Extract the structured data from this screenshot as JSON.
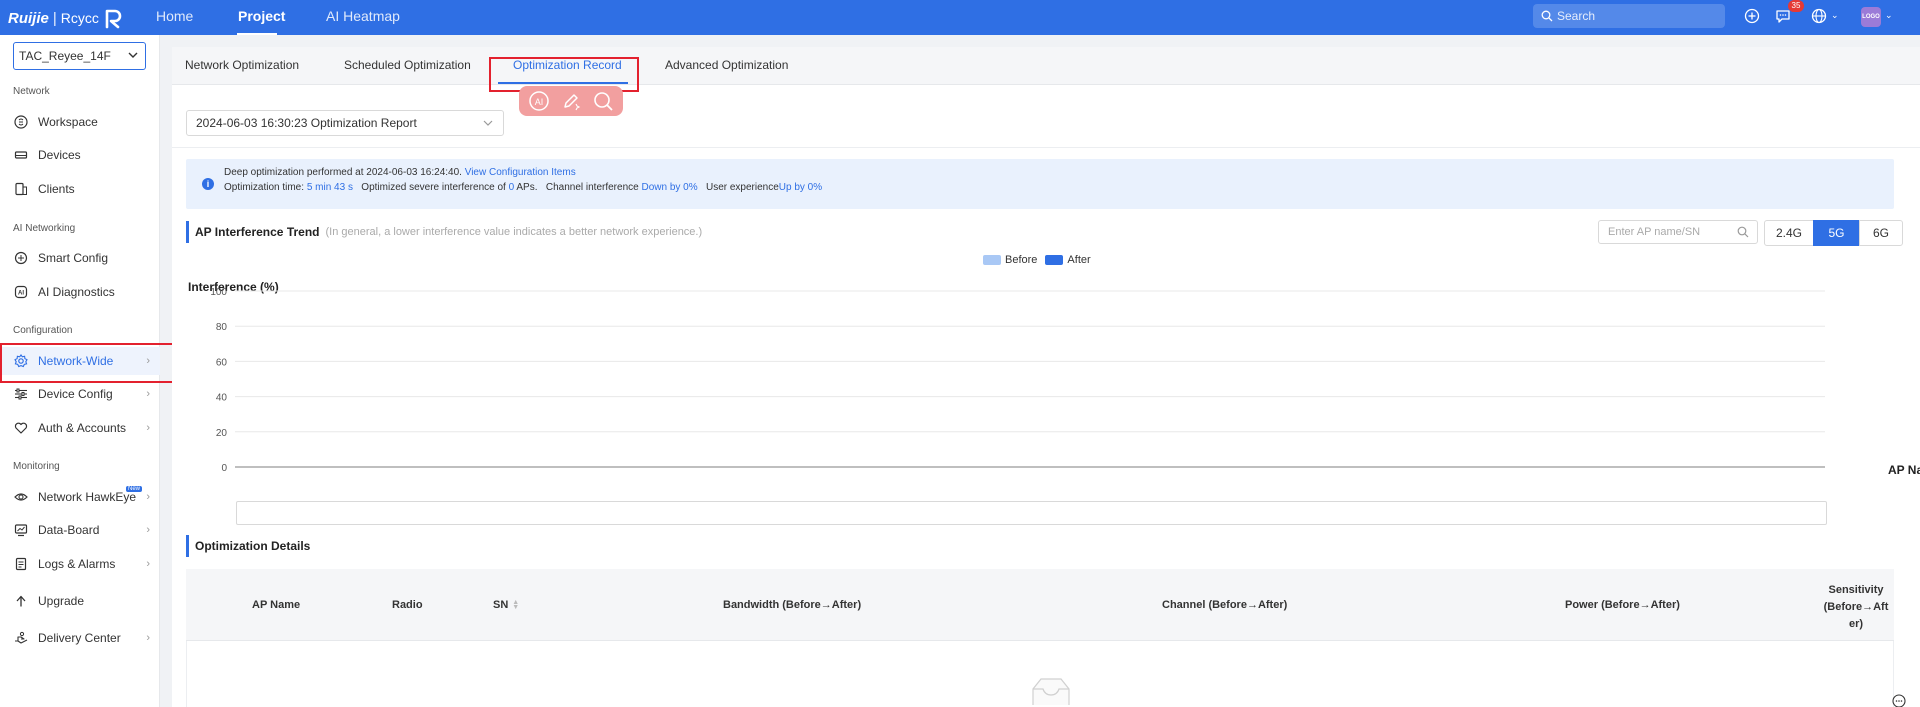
{
  "topbar": {
    "logo_brand": "Ruijie",
    "logo_sep": "|",
    "logo_product": "Rcycc",
    "nav": [
      {
        "label": "Home"
      },
      {
        "label": "Project"
      },
      {
        "label": "AI Heatmap"
      }
    ],
    "search_placeholder": "Search",
    "notification_count": "35",
    "avatar_text": "LOGO"
  },
  "sidebar": {
    "project": "TAC_Reyee_14F",
    "sections": {
      "network": "Network",
      "ai_networking": "AI Networking",
      "configuration": "Configuration",
      "monitoring": "Monitoring"
    },
    "items": {
      "workspace": "Workspace",
      "devices": "Devices",
      "clients": "Clients",
      "smart_config": "Smart Config",
      "ai_diagnostics": "AI Diagnostics",
      "network_wide": "Network-Wide",
      "device_config": "Device Config",
      "auth_accounts": "Auth & Accounts",
      "network_hawkeye": "Network HawkEye",
      "hawkeye_tag": "New",
      "data_board": "Data-Board",
      "logs_alarms": "Logs & Alarms",
      "upgrade": "Upgrade",
      "delivery_center": "Delivery Center"
    }
  },
  "tabs": [
    {
      "label": "Network Optimization"
    },
    {
      "label": "Scheduled Optimization"
    },
    {
      "label": "Optimization Record"
    },
    {
      "label": "Advanced Optimization"
    }
  ],
  "report_select": "2024-06-03 16:30:23 Optimization Report",
  "info": {
    "line1_text": "Deep optimization performed at 2024-06-03 16:24:40.",
    "line1_link": "View Configuration Items",
    "time_label": "Optimization time:",
    "time_value": "5 min 43 s",
    "severe_text": "Optimized severe interference of",
    "severe_value": "0",
    "severe_unit": "APs.",
    "channel_label": "Channel interference",
    "channel_value": "Down by 0%",
    "ux_label": "User experience",
    "ux_value": "Up by 0%"
  },
  "trend": {
    "title": "AP Interference Trend",
    "hint": "(In general, a lower interference value indicates a better network experience.)",
    "search_placeholder": "Enter AP name/SN",
    "bands": [
      "2.4G",
      "5G",
      "6G"
    ],
    "active_band": "5G"
  },
  "chart_data": {
    "type": "bar",
    "ylabel": "Interference (%)",
    "xlabel": "AP Name",
    "ylim": [
      0,
      100
    ],
    "yticks": [
      "100",
      "80",
      "60",
      "40",
      "20",
      "0"
    ],
    "categories": [],
    "series": [
      {
        "name": "Before",
        "values": [],
        "color": "#a9c8f5"
      },
      {
        "name": "After",
        "values": [],
        "color": "#2f6fe4"
      }
    ],
    "grid": true,
    "legend": "top-center"
  },
  "details": {
    "title": "Optimization Details",
    "columns": {
      "ap_name": "AP Name",
      "radio": "Radio",
      "sn": "SN",
      "bandwidth": "Bandwidth (Before→After)",
      "channel": "Channel (Before→After)",
      "power": "Power (Before→After)",
      "sensitivity_l1": "Sensitivity",
      "sensitivity_l2": "(Before→Aft",
      "sensitivity_l3": "er)"
    }
  },
  "colors": {
    "primary": "#2f6fe4",
    "highlight": "#e3212e",
    "ai_pill": "#f29f9f"
  }
}
